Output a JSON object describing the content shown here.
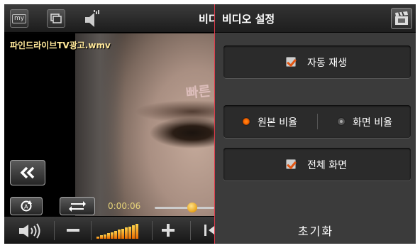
{
  "player": {
    "my_label": "my",
    "title_fragment": "비디",
    "filename": "파인드라이브TV광고.wmv",
    "watermark": "빠른",
    "timecode": "0:00:06",
    "seek_progress": 0.63,
    "volume_level_bars": 12
  },
  "settings": {
    "title": "비디오 설정",
    "auto_play": {
      "label": "자동 재생",
      "checked": true
    },
    "aspect": {
      "original_label": "원본 비율",
      "screen_label": "화면 비율",
      "selected": "original"
    },
    "fullscreen": {
      "label": "전체 화면",
      "checked": true
    },
    "reset_label": "초기화"
  },
  "colors": {
    "accent_orange": "#e25512",
    "panel_bg": "#3b3b3b",
    "divider_red": "#e03a4a",
    "timecode": "#e8d57a",
    "filename": "#ffe89a"
  },
  "icons": {
    "top_left": [
      "my-icon",
      "window-icon",
      "speaker-icon"
    ],
    "panel": "clapperboard-icon",
    "controls": [
      "rewind-icon",
      "repeat-icon",
      "swap-icon",
      "volume-icon",
      "minus-icon",
      "plus-icon",
      "skip-previous-icon"
    ]
  }
}
